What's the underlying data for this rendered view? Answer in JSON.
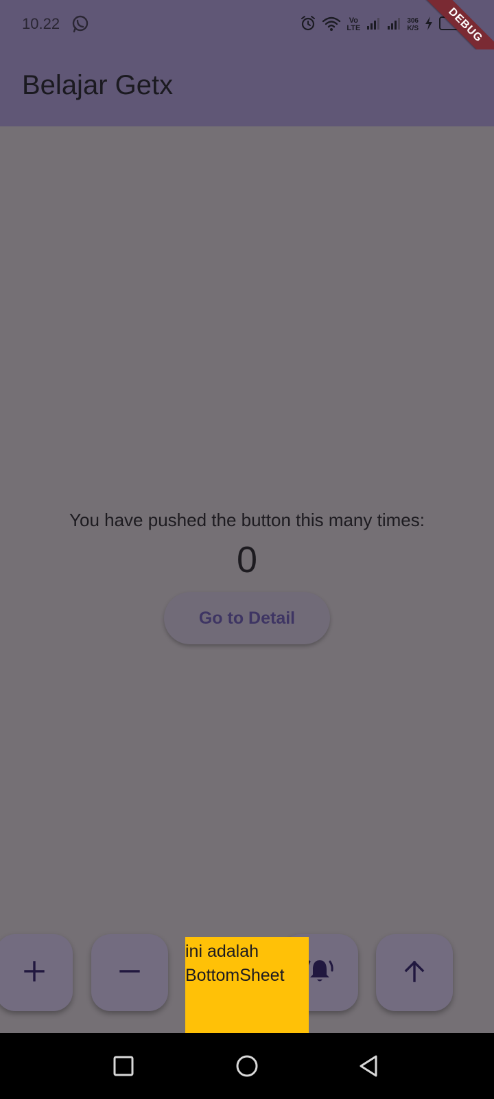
{
  "status_bar": {
    "time": "10.22",
    "network_label_top": "Vo",
    "network_label_bottom": "LTE",
    "speed_value": "306",
    "speed_unit": "K/S",
    "icons": [
      "whatsapp-icon",
      "alarm-icon",
      "wifi-icon",
      "signal-icon",
      "signal-icon",
      "charging-icon",
      "battery-icon"
    ]
  },
  "debug_banner": {
    "label": "DEBUG"
  },
  "app_bar": {
    "title": "Belajar Getx"
  },
  "main": {
    "counter_label": "You have pushed the button this many times:",
    "counter_value": "0",
    "detail_button_label": "Go to Detail"
  },
  "fabs": [
    {
      "icon": "add-icon"
    },
    {
      "icon": "remove-icon"
    },
    {
      "icon": "notification-bell-icon"
    },
    {
      "icon": "arrow-up-icon"
    }
  ],
  "bottom_sheet": {
    "text": "ini adalah BottomSheet",
    "background": "#ffc107"
  },
  "nav_bar": {
    "buttons": [
      "recent-apps-icon",
      "home-icon",
      "back-icon"
    ]
  },
  "colors": {
    "app_bar": "#605776",
    "scrim_background": "#757075",
    "primary_text": "#3e3563"
  }
}
